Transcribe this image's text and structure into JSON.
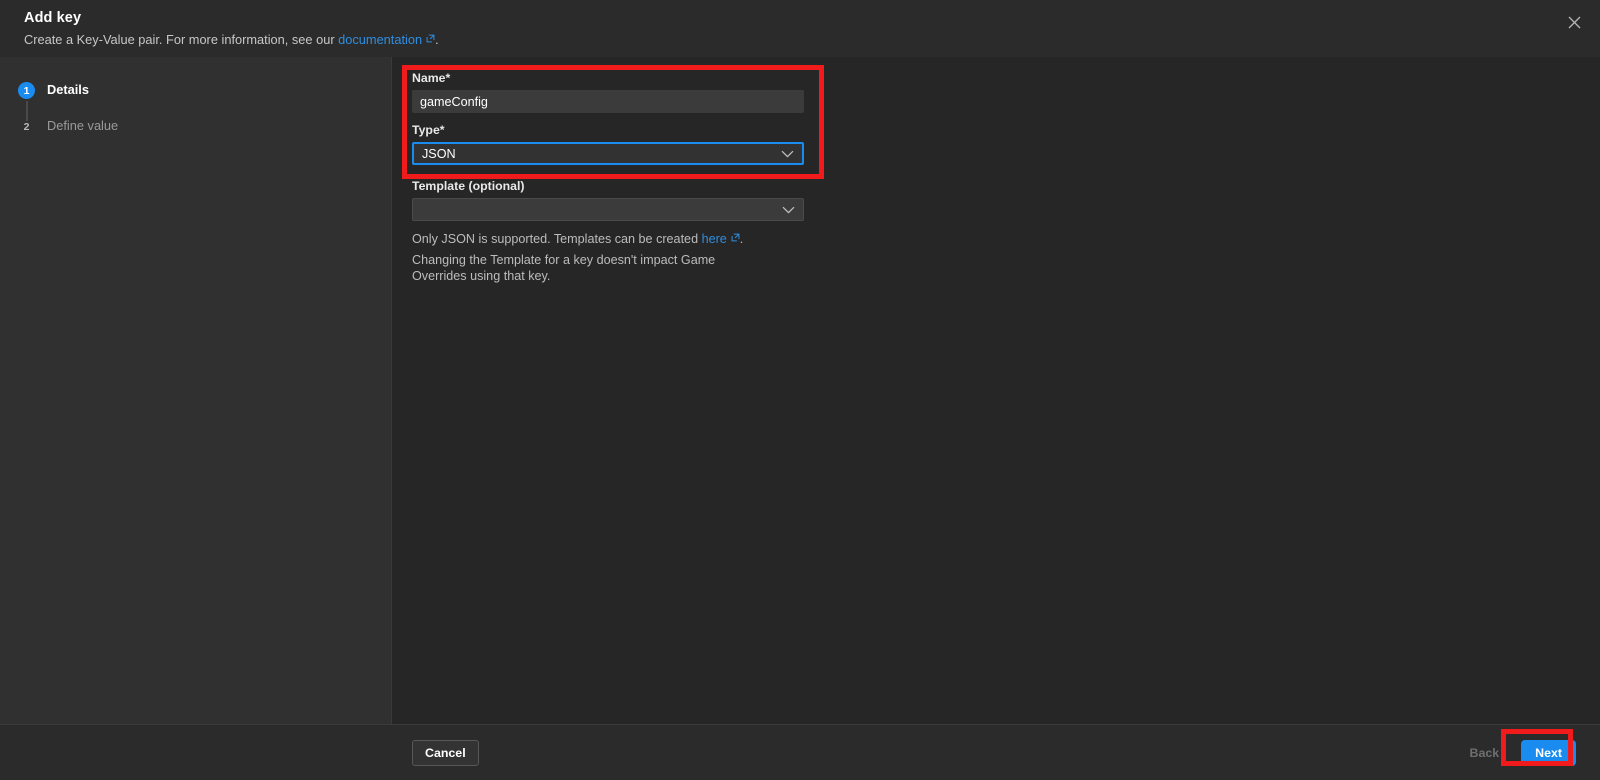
{
  "header": {
    "title": "Add key",
    "subtitle_before": "Create a Key-Value pair. For more information, see our ",
    "documentation_link": "documentation",
    "subtitle_after": ".",
    "close_icon": "close-icon"
  },
  "sidebar": {
    "steps": [
      {
        "number": "1",
        "label": "Details",
        "state": "active"
      },
      {
        "number": "2",
        "label": "Define value",
        "state": "inactive"
      }
    ]
  },
  "form": {
    "name": {
      "label": "Name*",
      "value": "gameConfig",
      "placeholder": ""
    },
    "type": {
      "label": "Type*",
      "value": "JSON",
      "focused": true,
      "chevron_icon": "chevron-down-icon"
    },
    "template": {
      "label": "Template (optional)",
      "value": "",
      "placeholder": "",
      "chevron_icon": "chevron-down-icon"
    },
    "helper_1_before": "Only JSON is supported. Templates can be created ",
    "helper_1_link": "here",
    "helper_1_after": ".",
    "helper_2": "Changing the Template for a key doesn't impact Game Overrides using that key."
  },
  "footer": {
    "cancel_label": "Cancel",
    "back_label": "Back",
    "back_disabled": true,
    "next_label": "Next"
  },
  "colors": {
    "accent_blue": "#1a8cf0",
    "link_blue": "#2f8ee0",
    "annotation_red": "#f11b1b",
    "panel_bg": "#262626",
    "sidebar_bg": "#303030",
    "header_bg": "#2b2b2b",
    "input_bg": "#3b3b3b"
  }
}
